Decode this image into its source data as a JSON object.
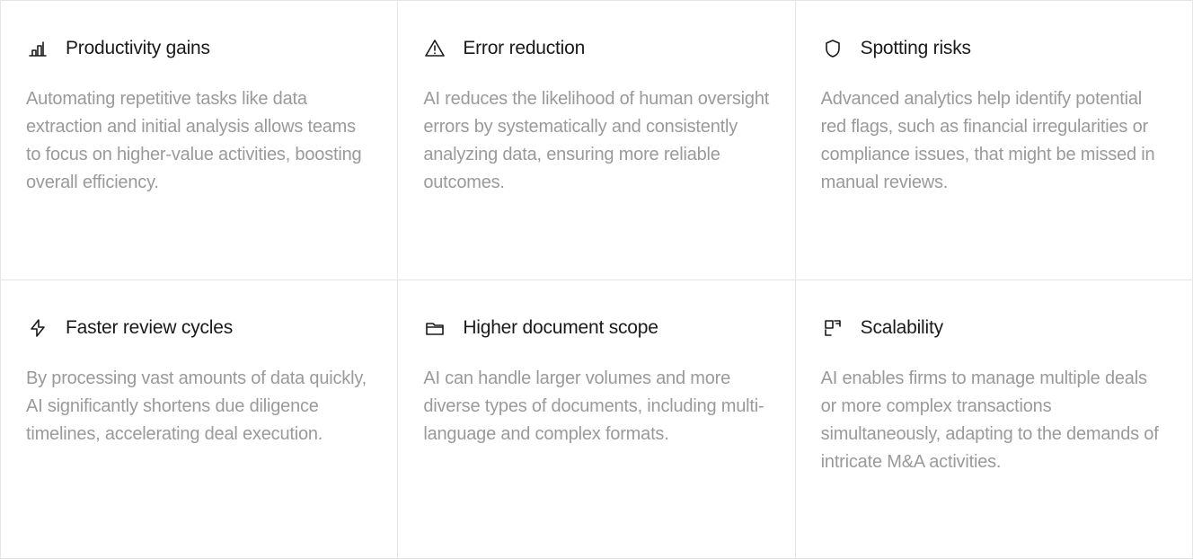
{
  "cards": [
    {
      "icon": "bar-chart-icon",
      "title": "Productivity gains",
      "description": "Automating repetitive tasks like data extraction and initial analysis allows teams to focus on higher-value activities, boosting overall efficiency."
    },
    {
      "icon": "warning-icon",
      "title": "Error reduction",
      "description": "AI reduces the likelihood of human oversight errors by systematically and consistently analyzing data, ensuring more reliable outcomes."
    },
    {
      "icon": "shield-icon",
      "title": "Spotting risks",
      "description": "Advanced analytics help identify potential red flags, such as financial irregularities or compliance issues, that might be missed in manual reviews."
    },
    {
      "icon": "lightning-icon",
      "title": "Faster review cycles",
      "description": "By processing vast amounts of data quickly, AI significantly shortens due diligence timelines, accelerating deal execution."
    },
    {
      "icon": "folder-icon",
      "title": "Higher document scope",
      "description": "AI can handle larger volumes and more diverse types of documents, including multi-language and complex formats."
    },
    {
      "icon": "expand-icon",
      "title": "Scalability",
      "description": "AI enables firms to manage multiple deals or more complex transactions simultaneously, adapting to the demands of intricate M&A activities."
    }
  ]
}
